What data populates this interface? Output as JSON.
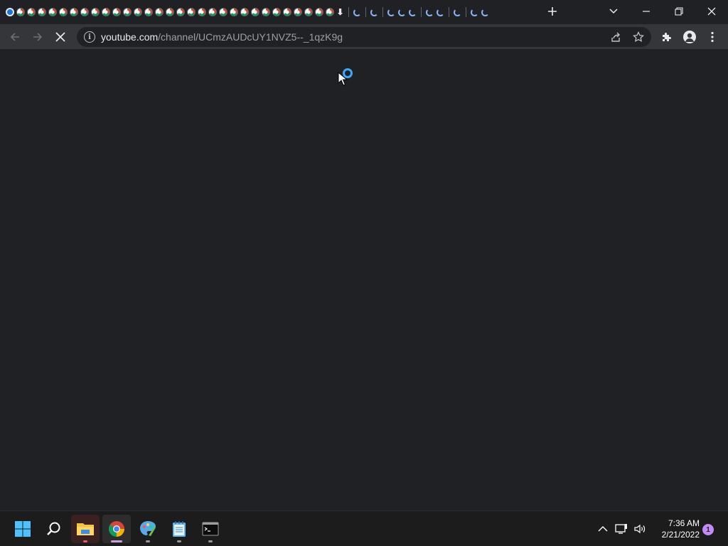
{
  "tabstrip": {
    "tab_count_icons": 30,
    "new_tab_icon": "plus-icon",
    "tab_search_icon": "chevron-down-icon",
    "window_controls": [
      "minimize-icon",
      "restore-icon",
      "close-icon"
    ]
  },
  "toolbar": {
    "back_icon": "arrow-left-icon",
    "forward_icon": "arrow-right-icon",
    "stop_icon": "close-icon",
    "omnibox": {
      "host": "youtube.com",
      "path": "/channel/UCmzAUDcUY1NVZ5--_1qzK9g",
      "info_glyph": "i"
    },
    "share_icon": "share-icon",
    "bookmark_icon": "star-icon",
    "extensions_icon": "puzzle-icon",
    "profile_icon": "person-icon",
    "menu_icon": "kebab-icon"
  },
  "content": {
    "state": "loading",
    "spinner_icon": "loading-spinner-icon"
  },
  "taskbar": {
    "apps": [
      {
        "name": "start",
        "icon": "windows-icon"
      },
      {
        "name": "search",
        "icon": "search-icon"
      },
      {
        "name": "file-explorer",
        "icon": "folder-icon"
      },
      {
        "name": "chrome",
        "icon": "chrome-icon"
      },
      {
        "name": "paint",
        "icon": "paint-icon"
      },
      {
        "name": "notepad",
        "icon": "notepad-icon"
      },
      {
        "name": "terminal",
        "icon": "terminal-icon"
      }
    ],
    "tray": {
      "overflow_icon": "chevron-up-icon",
      "network_icon": "network-icon",
      "volume_icon": "volume-icon",
      "time": "7:36 AM",
      "date": "2/21/2022",
      "notification_count": "1"
    }
  },
  "colors": {
    "background": "#202124",
    "toolbar": "#35363a",
    "spinner": "#3ea6ff",
    "taskbar": "#1c1c1c"
  }
}
